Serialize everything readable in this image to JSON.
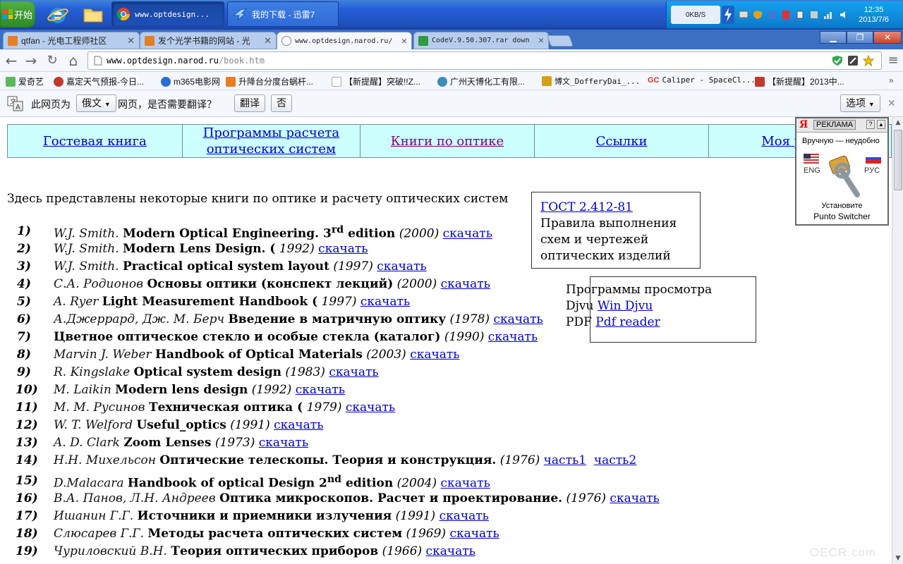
{
  "taskbar": {
    "start_label": "开始",
    "tasks": [
      {
        "label": "www.optdesign..."
      },
      {
        "label": "我的下载 - 迅雷7"
      }
    ],
    "net_speed": "0KB/S",
    "clock_time": "12:35",
    "clock_date": "2013/7/6"
  },
  "tabs": [
    {
      "title": "qtfan - 光电工程师社区"
    },
    {
      "title": "发个光学书籍的网站 - 光"
    },
    {
      "title": "www.optdesign.narod.ru/"
    },
    {
      "title": "CodeV.9.50.307.rar down"
    }
  ],
  "omnibox": {
    "host": "www.optdesign.narod.ru",
    "path": "/book.htm"
  },
  "bookmarks": [
    {
      "label": "爱奇艺"
    },
    {
      "label": "嘉定天气预报-今日..."
    },
    {
      "label": "m365电影网"
    },
    {
      "label": "升降台分度台蜗杆..."
    },
    {
      "label": "【新提醒】突破!!Z..."
    },
    {
      "label": "广州天博化工有限..."
    },
    {
      "label": "博文_DofferyDai_..."
    },
    {
      "label": "Caliper - SpaceCl..."
    },
    {
      "label": "【新提醒】2013中..."
    }
  ],
  "translate_bar": {
    "prefix": "此网页为",
    "language": "俄文",
    "suffix": "网页，是否需要翻译？",
    "translate_button": "翻译",
    "no_button": "否",
    "options_button": "选项"
  },
  "site_nav": [
    {
      "label": "Гостевая книга"
    },
    {
      "label": "Программы расчета оптических систем"
    },
    {
      "label": "Книги по оптике"
    },
    {
      "label": "Ссылки"
    },
    {
      "label": "Моя р"
    }
  ],
  "intro": "Здесь представлены некоторые книги по оптике и расчету оптических систем",
  "books": [
    {
      "num": "1)",
      "author": "W.J. Smith.",
      "title": "Modern Optical Engineering. 3",
      "sup": "rd",
      "title_tail": " edition",
      "year": "(2000)",
      "link": "скачать"
    },
    {
      "num": "2)",
      "author": "W.J. Smith.",
      "title": "Modern Lens Design. (",
      "sup": "",
      "title_tail": "",
      "year": "1992)",
      "link": "скачать"
    },
    {
      "num": "3)",
      "author": "W.J. Smith.",
      "title": "Practical optical system layout",
      "sup": "",
      "title_tail": "",
      "year": "(1997)",
      "link": "скачать"
    },
    {
      "num": "4)",
      "author": "С.А. Родионов",
      "title": "Основы оптики (конспект лекций)",
      "sup": "",
      "title_tail": "",
      "year": "(2000)",
      "link": "скачать"
    },
    {
      "num": "5)",
      "author": "A. Ryer",
      "title": "Light Measurement Handbook (",
      "sup": "",
      "title_tail": "",
      "year": "1997)",
      "link": "скачать"
    },
    {
      "num": "6)",
      "author": "А.Джеррард, Дж. М. Берч",
      "title": "Введение в матричную оптику",
      "sup": "",
      "title_tail": "",
      "year": "(1978)",
      "link": "скачать"
    },
    {
      "num": "7)",
      "author": "",
      "title": "Цветное оптическое стекло и особые стекла (каталог)",
      "sup": "",
      "title_tail": "",
      "year": "(1990)",
      "link": "скачать"
    },
    {
      "num": "8)",
      "author": "Marvin J. Weber",
      "title": "Handbook of Optical Materials",
      "sup": "",
      "title_tail": "",
      "year": "(2003)",
      "link": "скачать"
    },
    {
      "num": "9)",
      "author": "R. Kingslake",
      "title": "Optical system design",
      "sup": "",
      "title_tail": "",
      "year": "(1983)",
      "link": "скачать"
    },
    {
      "num": "10)",
      "author": "M. Laikin",
      "title": "Modern lens design",
      "sup": "",
      "title_tail": "",
      "year": "(1992)",
      "link": "скачать"
    },
    {
      "num": "11)",
      "author": "М. М. Русинов",
      "title": "Техническая оптика (",
      "sup": "",
      "title_tail": "",
      "year": "1979)",
      "link": "скачать"
    },
    {
      "num": "12)",
      "author": "W. T. Welford",
      "title": "Useful_optics",
      "sup": "",
      "title_tail": "",
      "year": "(1991)",
      "link": "скачать"
    },
    {
      "num": "13)",
      "author": "A. D. Clark",
      "title": "Zoom Lenses",
      "sup": "",
      "title_tail": "",
      "year": "(1973)",
      "link": "скачать"
    },
    {
      "num": "14)",
      "author": "Н.Н. Михельсон",
      "title": "Оптические телескопы. Теория и конструкция.",
      "sup": "",
      "title_tail": "",
      "year": "(1976)",
      "link": "часть1",
      "link2": "часть2"
    },
    {
      "num": "15)",
      "author": "D.Malacara",
      "title": "Handbook of optical Design 2",
      "sup": "nd",
      "title_tail": " edition",
      "year": "(2004)",
      "link": "скачать"
    },
    {
      "num": "16)",
      "author": "В.А. Панов, Л.Н. Андреев",
      "title": "Оптика микроскопов. Расчет и проектирование.",
      "sup": "",
      "title_tail": "",
      "year": "(1976)",
      "link": "скачать"
    },
    {
      "num": "17)",
      "author": "Ишанин Г.Г.",
      "title": "Источники и приемники излучения",
      "sup": "",
      "title_tail": "",
      "year": "(1991)",
      "link": "скачать"
    },
    {
      "num": "18)",
      "author": "Слюсарев Г.Г.",
      "title": "Методы расчета оптических систем",
      "sup": "",
      "title_tail": "",
      "year": "(1969)",
      "link": "скачать"
    },
    {
      "num": "19)",
      "author": "Чуриловский В.Н.",
      "title": "Теория оптических приборов",
      "sup": "",
      "title_tail": "",
      "year": "(1966)",
      "link": "скачать"
    }
  ],
  "gost": {
    "link": "ГОСТ 2.412-81",
    "text": "Правила выполнения схем и чертежей оптических изделий"
  },
  "viewers": {
    "heading": "Программы просмотра",
    "djvu_label": "Djvu",
    "djvu_link": "Win Djvu",
    "pdf_label": "PDF",
    "pdf_link": "Pdf reader"
  },
  "ad": {
    "logo": "Я",
    "header": "РЕКЛАМА",
    "tagline": "Вручную — неудобно",
    "eng": "ENG",
    "rus": "РУС",
    "cta_line1": "Установите",
    "cta_line2": "Punto Switcher"
  },
  "watermark": "OECR.com",
  "colors": {
    "link": "#0000cc",
    "visited": "#800080",
    "nav_bg": "#ccffff"
  }
}
